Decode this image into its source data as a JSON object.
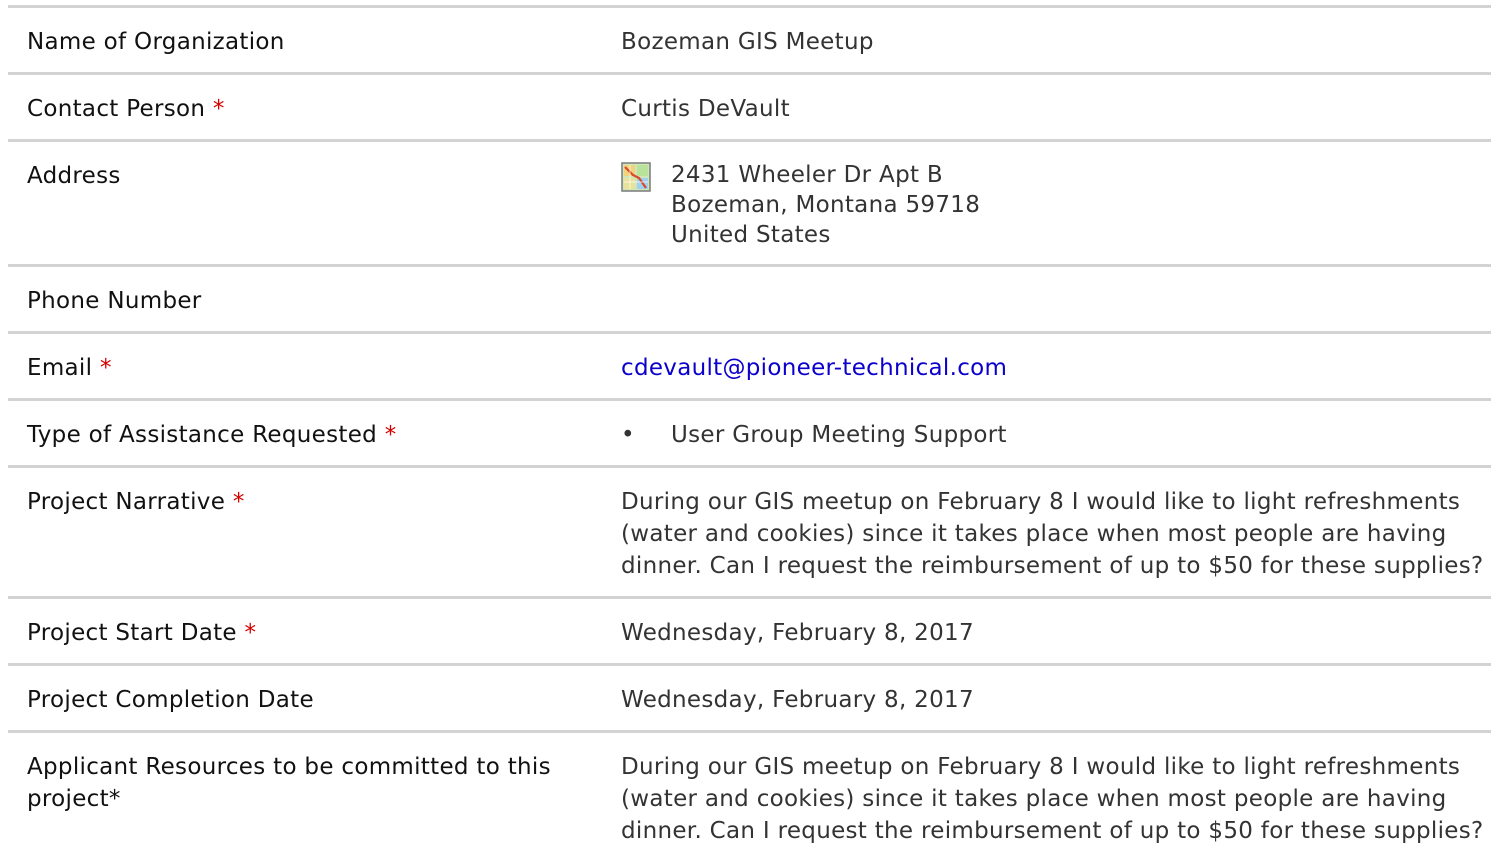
{
  "rows": {
    "organization": {
      "label": "Name of Organization",
      "value": "Bozeman GIS Meetup"
    },
    "contact": {
      "label": "Contact Person",
      "required": "*",
      "value": "Curtis DeVault"
    },
    "address": {
      "label": "Address",
      "icon": "map-icon",
      "line1": "2431 Wheeler Dr Apt B",
      "line2": "Bozeman, Montana 59718",
      "line3": "United States"
    },
    "phone": {
      "label": "Phone Number",
      "value": ""
    },
    "email": {
      "label": "Email",
      "required": "*",
      "value": "cdevault@pioneer-technical.com"
    },
    "assistance": {
      "label": "Type of Assistance Requested",
      "required": "*",
      "bullet": "•",
      "value": "User Group Meeting Support"
    },
    "narrative": {
      "label": "Project Narrative",
      "required": "*",
      "value": "During our GIS meetup on February 8 I would like to light refreshments (water and cookies) since it takes place when most people are having dinner. Can I request the reimbursement of up to $50 for these supplies?"
    },
    "start_date": {
      "label": "Project Start Date",
      "required": "*",
      "value": "Wednesday, February 8, 2017"
    },
    "completion_date": {
      "label": "Project Completion Date",
      "value": "Wednesday, February 8, 2017"
    },
    "resources": {
      "label": "Applicant Resources to be committed to this project*",
      "value": "During our GIS meetup on February 8 I would like to light refreshments (water and cookies) since it takes place when most people are having dinner. Can I request the reimbursement of up to $50 for these supplies?"
    }
  },
  "colors": {
    "required": "#d40000",
    "link": "#0b00cc",
    "divider": "#d3d3d3"
  }
}
